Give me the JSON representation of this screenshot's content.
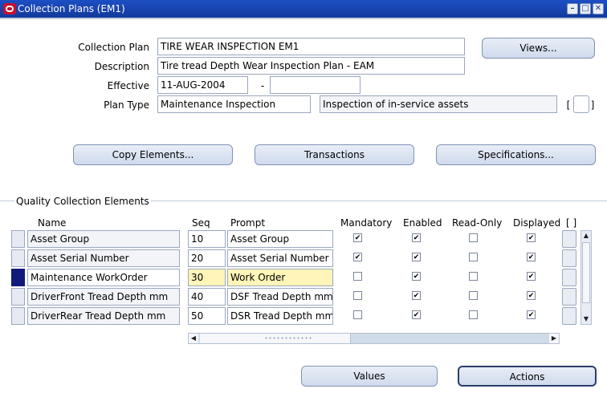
{
  "window": {
    "title": "Collection Plans (EM1)"
  },
  "header_form": {
    "collection_plan_label": "Collection Plan",
    "collection_plan_value": "TIRE WEAR INSPECTION EM1",
    "description_label": "Description",
    "description_value": "Tire tread Depth Wear Inspection Plan - EAM",
    "effective_label": "Effective",
    "effective_from": "11-AUG-2004",
    "effective_sep": "-",
    "effective_to": "",
    "plan_type_label": "Plan Type",
    "plan_type_value": "Maintenance Inspection",
    "plan_type_desc": "Inspection of in-service assets",
    "dff_left": "[",
    "dff_right": "]"
  },
  "buttons": {
    "views": "Views...",
    "copy_elements": "Copy Elements...",
    "transactions": "Transactions",
    "specifications": "Specifications...",
    "values": "Values",
    "actions": "Actions"
  },
  "section": {
    "title": "Quality Collection Elements"
  },
  "table": {
    "headers": {
      "name": "Name",
      "seq": "Seq",
      "prompt": "Prompt",
      "mandatory": "Mandatory",
      "enabled": "Enabled",
      "read_only": "Read-Only",
      "displayed": "Displayed",
      "dff": "[ ]"
    },
    "rows": [
      {
        "name": "Asset Group",
        "seq": "10",
        "prompt": "Asset Group",
        "mandatory": true,
        "enabled": true,
        "read_only": false,
        "displayed": true,
        "current": false
      },
      {
        "name": "Asset Serial Number",
        "seq": "20",
        "prompt": "Asset Serial Number",
        "mandatory": true,
        "enabled": true,
        "read_only": false,
        "displayed": true,
        "current": false
      },
      {
        "name": "Maintenance WorkOrder",
        "seq": "30",
        "prompt": "Work Order",
        "mandatory": false,
        "enabled": true,
        "read_only": false,
        "displayed": true,
        "current": true
      },
      {
        "name": "DriverFront Tread Depth mm",
        "seq": "40",
        "prompt": "DSF Tread Depth mm",
        "mandatory": false,
        "enabled": true,
        "read_only": false,
        "displayed": true,
        "current": false
      },
      {
        "name": "DriverRear Tread Depth mm",
        "seq": "50",
        "prompt": "DSR Tread Depth mm",
        "mandatory": false,
        "enabled": true,
        "read_only": false,
        "displayed": true,
        "current": false
      }
    ]
  }
}
